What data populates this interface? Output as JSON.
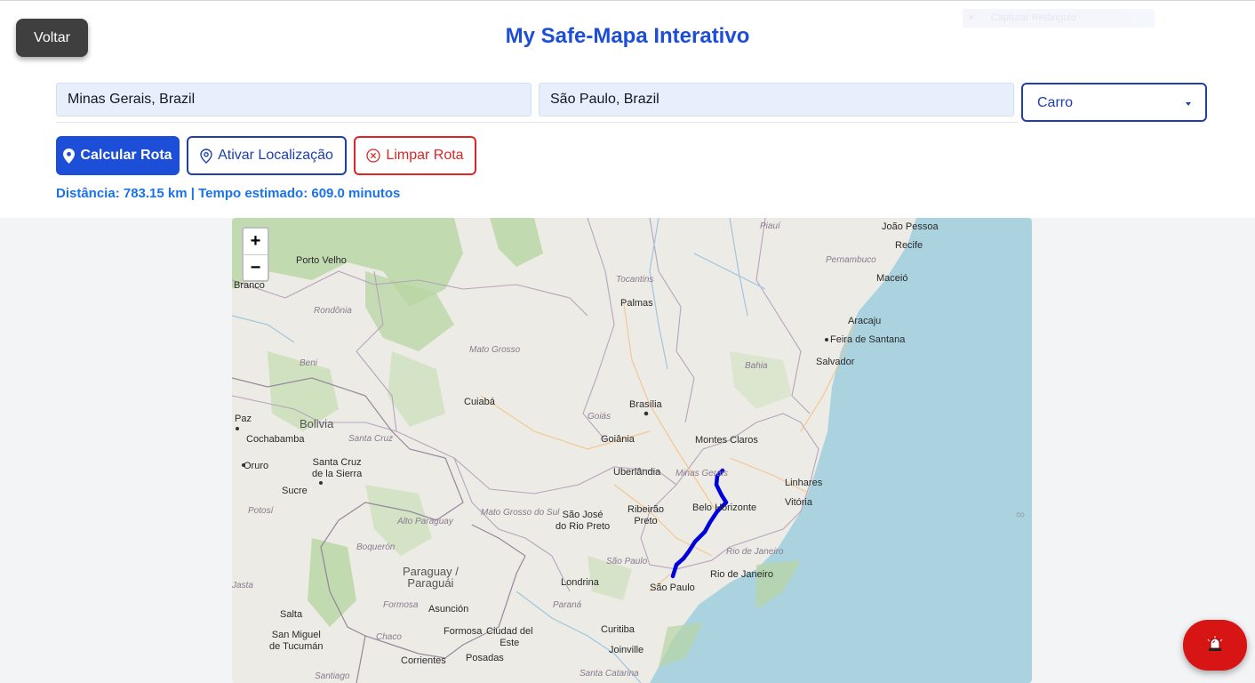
{
  "header": {
    "back_label": "Voltar",
    "title": "My Safe-Mapa Interativo",
    "capture_overlay_label": "Capturar Retângulo"
  },
  "form": {
    "origin_value": "Minas Gerais, Brazil",
    "destination_value": "São Paulo, Brazil",
    "mode_selected": "Carro"
  },
  "actions": {
    "calculate_label": "Calcular Rota",
    "locate_label": "Ativar Localização",
    "clear_label": "Limpar Rota"
  },
  "route_info": "Distância: 783.15 km | Tempo estimado: 609.0 minutos",
  "map": {
    "zoom_in": "+",
    "zoom_out": "−",
    "cities": [
      {
        "id": "joao-pessoa",
        "text": "João Pessoa"
      },
      {
        "id": "recife",
        "text": "Recife"
      },
      {
        "id": "maceio",
        "text": "Maceió"
      },
      {
        "id": "aracaju",
        "text": "Aracaju"
      },
      {
        "id": "feira-de-santana",
        "text": "Feira de Santana"
      },
      {
        "id": "salvador",
        "text": "Salvador"
      },
      {
        "id": "porto-velho",
        "text": "Porto Velho"
      },
      {
        "id": "branco",
        "text": "Branco"
      },
      {
        "id": "palmas",
        "text": "Palmas"
      },
      {
        "id": "cuiaba",
        "text": "Cuiabá"
      },
      {
        "id": "brasilia",
        "text": "Brasília"
      },
      {
        "id": "goiania",
        "text": "Goiânia"
      },
      {
        "id": "montes-claros",
        "text": "Montes Claros"
      },
      {
        "id": "uberlandia",
        "text": "Uberlândia"
      },
      {
        "id": "linhares",
        "text": "Linhares"
      },
      {
        "id": "vitoria",
        "text": "Vitória"
      },
      {
        "id": "belo-horizonte",
        "text": "Belo Horizonte"
      },
      {
        "id": "ribeirao-preto",
        "text": "Ribeirão\nPreto"
      },
      {
        "id": "sao-jose-do-rio-preto",
        "text": "São José\ndo Rio Preto"
      },
      {
        "id": "sao-paulo",
        "text": "São Paulo"
      },
      {
        "id": "rio-de-janeiro",
        "text": "Rio de Janeiro"
      },
      {
        "id": "londrina",
        "text": "Londrina"
      },
      {
        "id": "curitiba",
        "text": "Curitiba"
      },
      {
        "id": "joinville",
        "text": "Joinville"
      },
      {
        "id": "cochabamba",
        "text": "Cochabamba"
      },
      {
        "id": "santa-cruz-de-la-sierra",
        "text": "Santa Cruz\nde la Sierra"
      },
      {
        "id": "oruro",
        "text": "Oruro"
      },
      {
        "id": "sucre",
        "text": "Sucre"
      },
      {
        "id": "paz",
        "text": "Paz"
      },
      {
        "id": "asuncion",
        "text": "Asunción"
      },
      {
        "id": "formosa",
        "text": "Formosa"
      },
      {
        "id": "ciudad-del-este",
        "text": "Ciudad del\nEste"
      },
      {
        "id": "posadas",
        "text": "Posadas"
      },
      {
        "id": "corrientes",
        "text": "Corrientes"
      },
      {
        "id": "salta",
        "text": "Salta"
      },
      {
        "id": "san-miguel-de-tucuman",
        "text": "San Miguel\nde Tucumán"
      }
    ],
    "countries": [
      {
        "id": "bolivia",
        "text": "Bolivia"
      },
      {
        "id": "paraguay",
        "text": "Paraguay /\nParaguái"
      }
    ],
    "states": [
      {
        "id": "piaui",
        "text": "Piauí"
      },
      {
        "id": "pernambuco",
        "text": "Pernambuco"
      },
      {
        "id": "tocantins",
        "text": "Tocantins"
      },
      {
        "id": "rondonia",
        "text": "Rondônia"
      },
      {
        "id": "mato-grosso",
        "text": "Mato Grosso"
      },
      {
        "id": "bahia",
        "text": "Bahia"
      },
      {
        "id": "beni",
        "text": "Beni"
      },
      {
        "id": "goias",
        "text": "Goiás"
      },
      {
        "id": "minas-gerais",
        "text": "Minas Gerais"
      },
      {
        "id": "santa-cruz",
        "text": "Santa Cruz"
      },
      {
        "id": "mato-grosso-do-sul",
        "text": "Mato Grosso\ndo Sul"
      },
      {
        "id": "alto-paraguay",
        "text": "Alto Paraguay"
      },
      {
        "id": "potosi",
        "text": "Potosí"
      },
      {
        "id": "boqueron",
        "text": "Boquerón"
      },
      {
        "id": "sao-paulo-state",
        "text": "São Paulo"
      },
      {
        "id": "rio-de-janeiro-state",
        "text": "Rio de Janeiro"
      },
      {
        "id": "parana",
        "text": "Paraná"
      },
      {
        "id": "chaco",
        "text": "Chaco"
      },
      {
        "id": "santa-catarina",
        "text": "Santa Catarina"
      },
      {
        "id": "santiago",
        "text": "Santiago"
      },
      {
        "id": "jasta",
        "text": "Jasta"
      },
      {
        "id": "formosa-state",
        "text": "Formosa"
      }
    ]
  },
  "route_color": "#0000dd",
  "sos_icon": "siren-icon",
  "colors": {
    "primary": "#1d4ed8",
    "danger": "#dc2626",
    "info": "#1a73e8",
    "sos": "#d81515"
  }
}
